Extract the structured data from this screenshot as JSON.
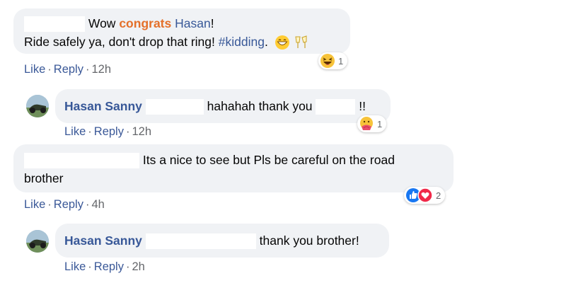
{
  "comments": [
    {
      "prefix": "Wow",
      "highlight": "congrats",
      "mention": "Hasan",
      "bang": "!",
      "line2_text": "Ride safely ya, don't drop that ring!",
      "hashtag": "#kidding",
      "period": ".",
      "reaction_count": "1",
      "like": "Like",
      "reply": "Reply",
      "time": "12h"
    },
    {
      "author": "Hasan Sanny",
      "text": "hahahah thank you",
      "suffix": "!!",
      "reaction_count": "1",
      "like": "Like",
      "reply": "Reply",
      "time": "12h"
    },
    {
      "text": "Its a nice to see but Pls be careful on the road",
      "line2_text": "brother",
      "reaction_count": "2",
      "like": "Like",
      "reply": "Reply",
      "time": "4h"
    },
    {
      "author": "Hasan Sanny",
      "text": "thank you brother!",
      "like": "Like",
      "reply": "Reply",
      "time": "2h"
    }
  ],
  "separator": "·",
  "icons": {
    "grin": "grinning-face-icon",
    "toast": "clinking-glasses-icon",
    "haha": "haha-reaction-icon",
    "care": "care-reaction-icon",
    "like": "like-reaction-icon",
    "love": "love-reaction-icon"
  },
  "colors": {
    "bubble": "#f0f2f5",
    "link": "#385898",
    "highlight": "#e4702a",
    "meta_text": "#65676b"
  }
}
